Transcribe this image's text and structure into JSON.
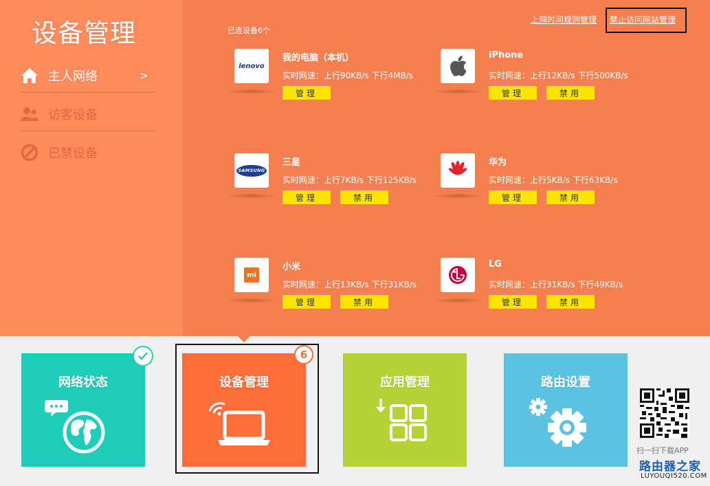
{
  "sidebar": {
    "title": "设备管理",
    "items": [
      {
        "label": "主人网络",
        "arrow": ">",
        "icon": "home-icon"
      },
      {
        "label": "访客设备",
        "icon": "users-icon"
      },
      {
        "label": "已禁设备",
        "icon": "blocked-icon"
      }
    ]
  },
  "header": {
    "link_time_rules": "上网时间规则管理",
    "link_block_sites": "禁止访问网站管理",
    "connected_count": "已连设备6个"
  },
  "devices": [
    {
      "name": "我的电脑（本机）",
      "speed": "实时网速：上行90KB/s  下行4MB/s",
      "logo": "lenovo",
      "btn_manage": "管理"
    },
    {
      "name": "iPhone",
      "speed": "实时网速：上行12KB/s  下行500KB/s",
      "logo": "apple-icon",
      "btn_manage": "管理",
      "btn_block": "禁用"
    },
    {
      "name": "三星",
      "speed": "实时网速：上行7KB/s  下行125KB/s",
      "logo": "SAMSUNG",
      "btn_manage": "管理",
      "btn_block": "禁用"
    },
    {
      "name": "华为",
      "speed": "实时网速：上行5KB/s  下行63KB/s",
      "logo": "huawei-icon",
      "btn_manage": "管理",
      "btn_block": "禁用"
    },
    {
      "name": "小米",
      "speed": "实时网速：上行13KB/s  下行31KB/s",
      "logo": "mi",
      "btn_manage": "管理",
      "btn_block": "禁用"
    },
    {
      "name": "LG",
      "speed": "实时网速：上行31KB/s  下行49KB/s",
      "logo": "lg-icon",
      "btn_manage": "管理",
      "btn_block": "禁用"
    }
  ],
  "tiles": [
    {
      "label": "网络状态",
      "color": "#1dcdb9",
      "icon": "globe-chat-icon"
    },
    {
      "label": "设备管理",
      "color": "#ff6d3a",
      "icon": "laptop-wifi-icon",
      "badge": "6"
    },
    {
      "label": "应用管理",
      "color": "#b5d334",
      "icon": "apps-grid-icon"
    },
    {
      "label": "路由设置",
      "color": "#5bc2e4",
      "icon": "gears-icon"
    }
  ],
  "footer": {
    "qr_caption": "扫一扫下载APP",
    "brand": "路由器之家",
    "brand_url": "LUYOUQI520.COM"
  },
  "colors": {
    "sidebar_bg": "#ff8a5c",
    "main_bg": "#f57f4f",
    "button_yellow": "#ffe400"
  }
}
